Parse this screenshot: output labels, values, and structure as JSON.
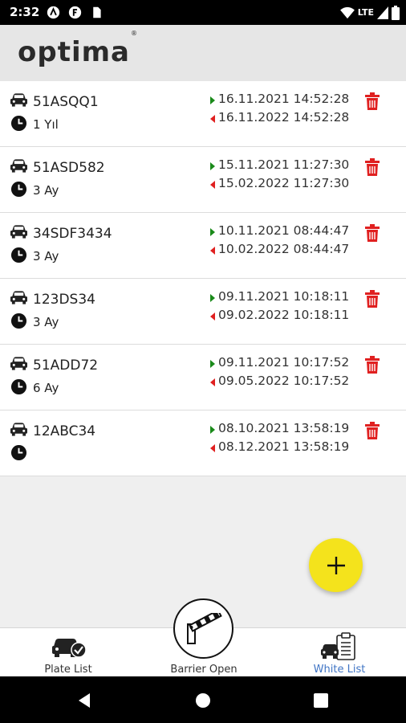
{
  "status_bar": {
    "time": "2:32",
    "network_label": "LTE"
  },
  "app": {
    "logo_text": "optima",
    "logo_mark": "®"
  },
  "colors": {
    "accent_fab": "#f4e31c",
    "delete_red": "#e02020",
    "start_arrow_green": "#1a8a1a",
    "end_arrow_red": "#e02020",
    "active_tab_blue": "#3f74c4"
  },
  "plates": [
    {
      "plate": "51ASQQ1",
      "duration": "1 Yıl",
      "start": "16.11.2021 14:52:28",
      "end": "16.11.2022 14:52:28"
    },
    {
      "plate": "51ASD582",
      "duration": "3 Ay",
      "start": "15.11.2021 11:27:30",
      "end": "15.02.2022 11:27:30"
    },
    {
      "plate": "34SDF3434",
      "duration": "3 Ay",
      "start": "10.11.2021 08:44:47",
      "end": "10.02.2022 08:44:47"
    },
    {
      "plate": "123DS34",
      "duration": "3 Ay",
      "start": "09.11.2021 10:18:11",
      "end": "09.02.2022 10:18:11"
    },
    {
      "plate": "51ADD72",
      "duration": "6 Ay",
      "start": "09.11.2021 10:17:52",
      "end": "09.05.2022 10:17:52"
    },
    {
      "plate": "12ABC34",
      "duration": "",
      "start": "08.10.2021 13:58:19",
      "end": "08.12.2021 13:58:19"
    }
  ],
  "fab": {
    "icon": "plus-icon"
  },
  "bottom_nav": {
    "items": [
      {
        "label": "Plate List",
        "icon": "car-check-icon",
        "active": false
      },
      {
        "label": "Barrier Open",
        "icon": "barrier-gate-icon",
        "active": false
      },
      {
        "label": "White List",
        "icon": "car-clipboard-icon",
        "active": true
      }
    ]
  }
}
